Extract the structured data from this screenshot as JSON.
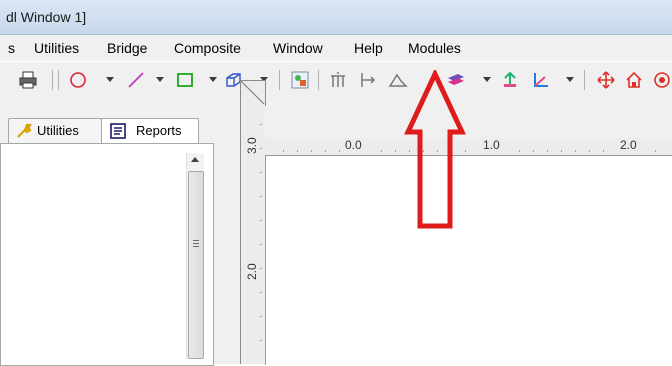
{
  "titlebar": {
    "title": "dl Window 1]"
  },
  "menu": {
    "items": [
      "s",
      "Utilities",
      "Bridge",
      "Composite",
      "Window",
      "Help",
      "Modules"
    ]
  },
  "toolbar": {
    "icons": [
      "print-icon",
      "circle-icon",
      "line-icon",
      "rectangle-icon",
      "3d-box-icon",
      "image-icon",
      "columns-icon",
      "support-icon",
      "mountain-icon",
      "layers-icon",
      "pin-icon",
      "axis-icon",
      "move-icon",
      "home-icon"
    ]
  },
  "panel": {
    "tabs": [
      {
        "label": "Utilities",
        "icon": "wrench-icon"
      },
      {
        "label": "Reports",
        "icon": "report-icon"
      }
    ]
  },
  "ruler": {
    "h_labels": [
      "0.0",
      "1.0",
      "2.0"
    ],
    "v_labels": [
      "3.0",
      "2.0"
    ]
  },
  "annotation": {
    "color": "#e01b1b",
    "shape": "up-arrow"
  }
}
